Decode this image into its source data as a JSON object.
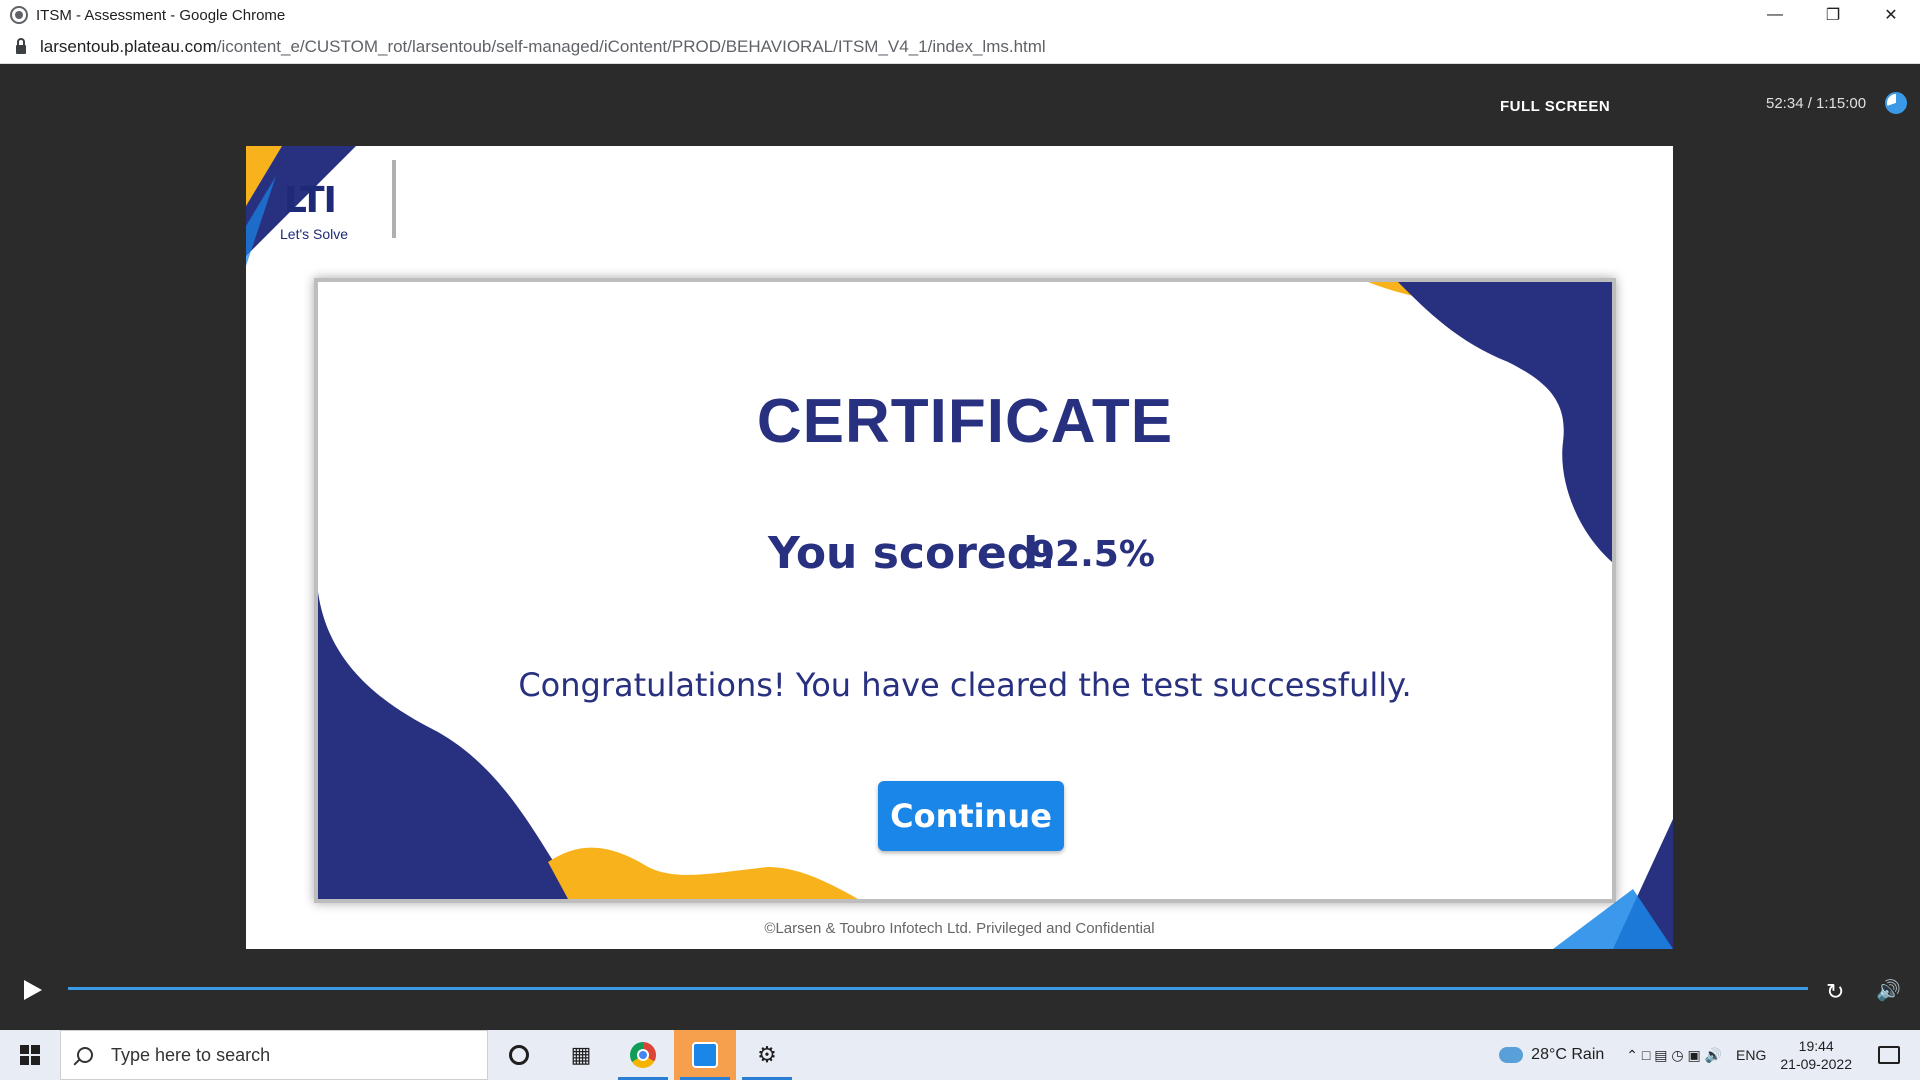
{
  "browser": {
    "window_title": "ITSM - Assessment - Google Chrome",
    "url_domain": "larsentoub.plateau.com",
    "url_path": "/icontent_e/CUSTOM_rot/larsentoub/self-managed/iContent/PROD/BEHAVIORAL/ITSM_V4_1/index_lms.html"
  },
  "player": {
    "fullscreen_label": "FULL SCREEN",
    "time": "52:34 / 1:15:00",
    "progress": 1.0,
    "accent_color": "#3a9ae8"
  },
  "slide": {
    "logo_text": "LTI",
    "logo_tagline": "Let's Solve",
    "title": "CERTIFICATE",
    "score_label": "You scored:",
    "score_value": "92.5%",
    "message": "Congratulations! You have cleared the test successfully.",
    "continue_label": "Continue",
    "footer": "©Larsen & Toubro Infotech Ltd. Privileged and Confidential",
    "colors": {
      "navy": "#283080",
      "orange": "#f8b21c",
      "button": "#1a86e8"
    }
  },
  "taskbar": {
    "search_placeholder": "Type here to search",
    "weather": "28°C  Rain",
    "language": "ENG",
    "time": "19:44",
    "date": "21-09-2022"
  }
}
